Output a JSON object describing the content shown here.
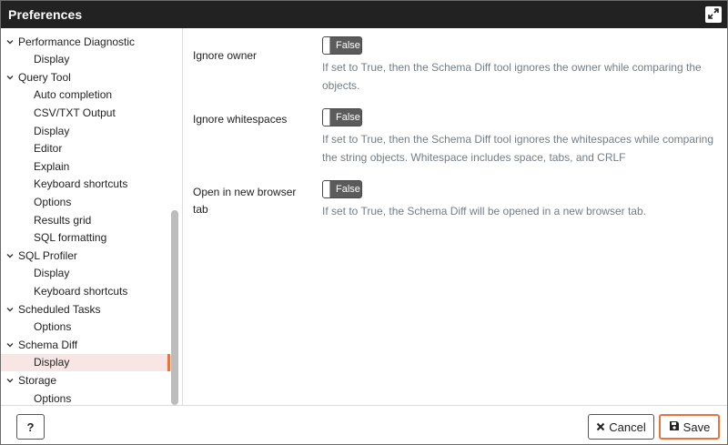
{
  "window": {
    "title": "Preferences"
  },
  "sidebar": {
    "items": [
      {
        "label": "Performance Diagnostic",
        "type": "parent"
      },
      {
        "label": "Display",
        "type": "child"
      },
      {
        "label": "Query Tool",
        "type": "parent"
      },
      {
        "label": "Auto completion",
        "type": "child"
      },
      {
        "label": "CSV/TXT Output",
        "type": "child"
      },
      {
        "label": "Display",
        "type": "child"
      },
      {
        "label": "Editor",
        "type": "child"
      },
      {
        "label": "Explain",
        "type": "child"
      },
      {
        "label": "Keyboard shortcuts",
        "type": "child"
      },
      {
        "label": "Options",
        "type": "child"
      },
      {
        "label": "Results grid",
        "type": "child"
      },
      {
        "label": "SQL formatting",
        "type": "child"
      },
      {
        "label": "SQL Profiler",
        "type": "parent"
      },
      {
        "label": "Display",
        "type": "child"
      },
      {
        "label": "Keyboard shortcuts",
        "type": "child"
      },
      {
        "label": "Scheduled Tasks",
        "type": "parent"
      },
      {
        "label": "Options",
        "type": "child"
      },
      {
        "label": "Schema Diff",
        "type": "parent"
      },
      {
        "label": "Display",
        "type": "child",
        "selected": true
      },
      {
        "label": "Storage",
        "type": "parent"
      },
      {
        "label": "Options",
        "type": "child"
      }
    ]
  },
  "preferences": [
    {
      "label": "Ignore owner",
      "value": "False",
      "help": "If set to True, then the Schema Diff tool ignores the owner while comparing the objects."
    },
    {
      "label": "Ignore whitespaces",
      "value": "False",
      "help": "If set to True, then the Schema Diff tool ignores the whitespaces while comparing the string objects. Whitespace includes space, tabs, and CRLF"
    },
    {
      "label": "Open in new browser tab",
      "value": "False",
      "help": "If set to True, the Schema Diff will be opened in a new browser tab."
    }
  ],
  "footer": {
    "help_label": "?",
    "cancel_label": "Cancel",
    "save_label": "Save"
  },
  "colors": {
    "titlebar": "#222222",
    "accent": "#e8743b",
    "selected_bg": "#f8e6e4",
    "toggle_off": "#5b5b5b",
    "help_text": "#737c86"
  },
  "icons": {
    "maximize": "expand-arrows-icon",
    "tree_expanded": "chevron-down-icon",
    "cancel": "x-icon",
    "save": "floppy-disk-icon"
  }
}
